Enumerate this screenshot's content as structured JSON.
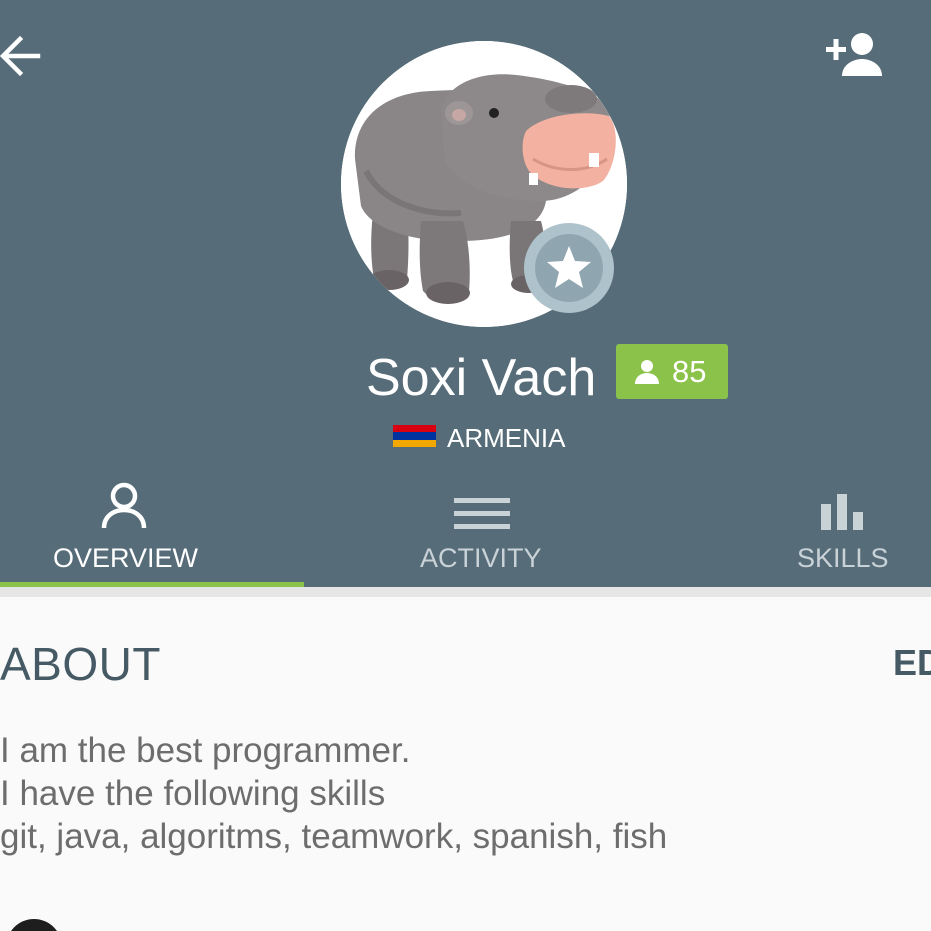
{
  "header": {
    "background_color": "#566c78",
    "back_icon": "arrow-left-icon",
    "add_friend_icon": "person-add-icon"
  },
  "profile": {
    "avatar_description": "plush-hippo-avatar",
    "badge_icon": "star-icon",
    "name": "Soxi Vach",
    "level": "85",
    "level_icon": "person-icon",
    "level_color": "#8bc34a",
    "country": "ARMENIA",
    "flag_colors": [
      "#d90012",
      "#0033a0",
      "#f2a800"
    ]
  },
  "tabs": [
    {
      "label": "OVERVIEW",
      "icon": "person-outline-icon",
      "active": true
    },
    {
      "label": "ACTIVITY",
      "icon": "menu-lines-icon",
      "active": false
    },
    {
      "label": "SKILLS",
      "icon": "bar-chart-icon",
      "active": false
    }
  ],
  "about": {
    "title": "ABOUT",
    "edit_label": "ED",
    "lines": [
      "I am the best programmer.",
      "I have the following skills",
      "git, java, algoritms, teamwork, spanish, fish"
    ]
  }
}
